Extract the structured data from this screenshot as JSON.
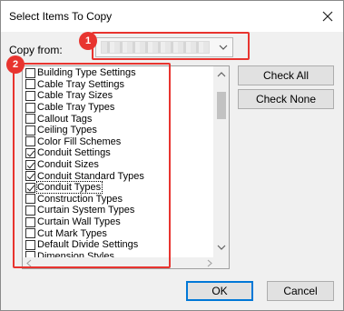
{
  "window": {
    "title": "Select Items To Copy"
  },
  "copy_from": {
    "label": "Copy from:"
  },
  "annotations": {
    "badge_1": "1",
    "badge_2": "2"
  },
  "items": [
    {
      "label": "Building Type Settings",
      "checked": false
    },
    {
      "label": "Cable Tray Settings",
      "checked": false
    },
    {
      "label": "Cable Tray Sizes",
      "checked": false
    },
    {
      "label": "Cable Tray Types",
      "checked": false
    },
    {
      "label": "Callout Tags",
      "checked": false
    },
    {
      "label": "Ceiling Types",
      "checked": false
    },
    {
      "label": "Color Fill Schemes",
      "checked": false
    },
    {
      "label": "Conduit Settings",
      "checked": true
    },
    {
      "label": "Conduit Sizes",
      "checked": true
    },
    {
      "label": "Conduit Standard Types",
      "checked": true
    },
    {
      "label": "Conduit Types",
      "checked": true,
      "focused": true
    },
    {
      "label": "Construction Types",
      "checked": false
    },
    {
      "label": "Curtain System Types",
      "checked": false
    },
    {
      "label": "Curtain Wall Types",
      "checked": false
    },
    {
      "label": "Cut Mark Types",
      "checked": false
    },
    {
      "label": "Default Divide Settings",
      "checked": false
    },
    {
      "label": "Dimension Styles",
      "checked": false
    }
  ],
  "buttons": {
    "check_all": "Check All",
    "check_none": "Check None",
    "ok": "OK",
    "cancel": "Cancel"
  },
  "colors": {
    "annotation": "#e8342f",
    "default_button_border": "#0078d7"
  }
}
